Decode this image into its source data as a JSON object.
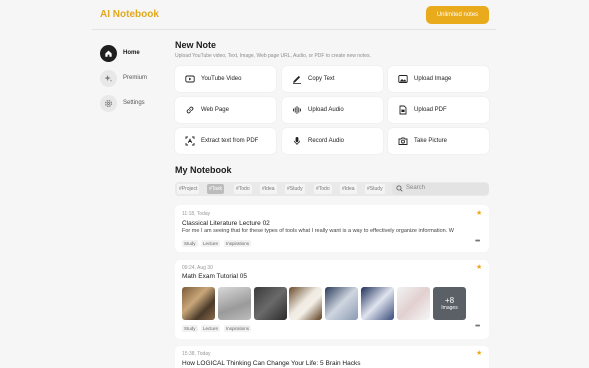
{
  "app": {
    "title": "AI Notebook",
    "cta_label": "Unlimited notes"
  },
  "nav": [
    {
      "label": "Home",
      "icon": "home-icon",
      "active": true
    },
    {
      "label": "Premium",
      "icon": "sparkle-icon",
      "active": false
    },
    {
      "label": "Settings",
      "icon": "gear-icon",
      "active": false
    }
  ],
  "new_note": {
    "title": "New Note",
    "subtitle": "Upload YouTube video, Text, Image, Web page URL, Audio, or PDF to create new notes.",
    "cards": [
      {
        "label": "YouTube Video",
        "icon": "youtube-icon"
      },
      {
        "label": "Copy Text",
        "icon": "pencil-icon"
      },
      {
        "label": "Upload Image",
        "icon": "image-icon"
      },
      {
        "label": "Web Page",
        "icon": "link-icon"
      },
      {
        "label": "Upload Audio",
        "icon": "audio-wave-icon"
      },
      {
        "label": "Upload PDF",
        "icon": "pdf-icon"
      },
      {
        "label": "Extract text from PDF",
        "icon": "scan-icon"
      },
      {
        "label": "Record Audio",
        "icon": "microphone-icon"
      },
      {
        "label": "Take Picture",
        "icon": "camera-icon"
      }
    ]
  },
  "notebook": {
    "title": "My Notebook",
    "chips": [
      "#Project",
      "#Task",
      "#Todo",
      "#Idea",
      "#Study",
      "#Todo",
      "#Idea",
      "#Study"
    ],
    "selected_chip": 1,
    "search_placeholder": "Search",
    "notes": [
      {
        "timestamp": "11:18, Today",
        "title": "Classical Literature Lecture 02",
        "body": "For me I am seeing that for these types of tools what I really want is a way to effectively organize information. W",
        "tags": [
          "Study",
          "Lecture",
          "Inspirations"
        ],
        "starred": true
      },
      {
        "timestamp": "09:24, Aug 30",
        "title": "Math Exam Tutorial 05",
        "tags": [
          "Study",
          "Lecture",
          "Inspirations"
        ],
        "starred": true,
        "images_more": {
          "count": "+8",
          "label": "Images"
        }
      },
      {
        "timestamp": "15:38, Today",
        "title": "How LOGICAL Thinking Can Change Your Life: 5 Brain Hacks",
        "starred": true
      }
    ]
  },
  "colors": {
    "accent": "#e9ab1c",
    "background": "#f6f6f6",
    "card": "#ffffff"
  }
}
